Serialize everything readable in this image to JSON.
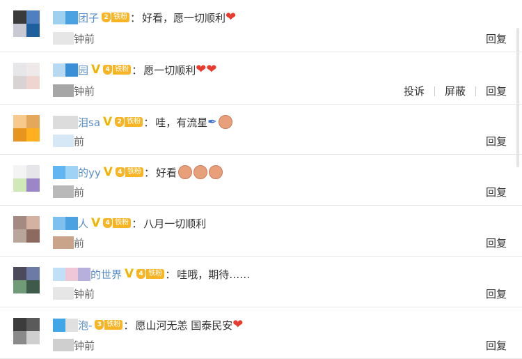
{
  "comments": [
    {
      "name_visible": "团子",
      "fan_label": "铁粉",
      "fan_level": "2",
      "separator": "：",
      "text": "好看，愿一切顺利",
      "emojis": [
        "❤"
      ],
      "time_visible": "钟前",
      "actions": [
        "回复"
      ]
    },
    {
      "name_visible": "园",
      "fan_label": "铁粉",
      "fan_level": "4",
      "separator": "：",
      "text": "愿一切顺利",
      "emojis": [
        "❤",
        "❤"
      ],
      "time_visible": "钟前",
      "actions": [
        "投诉",
        "屏蔽",
        "回复"
      ]
    },
    {
      "name_visible": "泪sa",
      "fan_label": "铁粉",
      "fan_level": "2",
      "separator": "：",
      "text": "哇，有流星",
      "emojis": [
        "pen",
        "face"
      ],
      "time_visible": "前",
      "actions": [
        "回复"
      ]
    },
    {
      "name_visible": "的yy",
      "fan_label": "铁粉",
      "fan_level": "4",
      "separator": "：",
      "text": "好看",
      "emojis": [
        "face",
        "face",
        "face"
      ],
      "time_visible": "前",
      "actions": [
        "回复"
      ]
    },
    {
      "name_visible": "人",
      "fan_label": "铁粉",
      "fan_level": "4",
      "separator": "：",
      "text": "八月一切顺利",
      "emojis": [],
      "time_visible": "前",
      "actions": [
        "回复"
      ]
    },
    {
      "name_visible": "的世界",
      "fan_label": "铁粉",
      "fan_level": "4",
      "separator": "：",
      "text": "哇哦，期待……",
      "emojis": [],
      "time_visible": "钟前",
      "actions": [
        "回复"
      ]
    },
    {
      "name_visible": "泡-",
      "fan_label": "铁粉",
      "fan_level": "3",
      "separator": "：",
      "text": "愿山河无恙 国泰民安",
      "emojis": [
        "❤"
      ],
      "time_visible": "钟前",
      "actions": [
        "回复"
      ]
    }
  ],
  "colors": {
    "username": "#5b8fc9",
    "badge": "#f7b425",
    "vip_v": "#f0b400",
    "heart": "#e83b2f",
    "divider": "#e6e6e6"
  },
  "icons": {
    "verified": "verified-v-icon",
    "fan_badge": "fan-badge-icon",
    "heart": "heart-emoji-icon",
    "face": "facepalm-emoji-icon",
    "pen": "pen-emoji-icon"
  }
}
